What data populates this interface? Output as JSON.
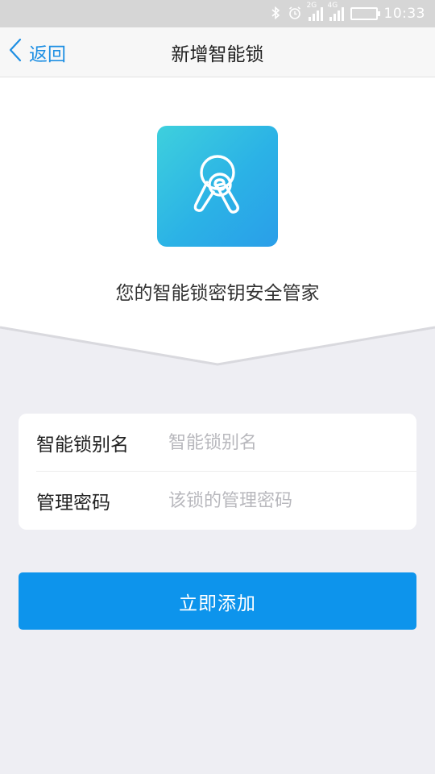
{
  "status_bar": {
    "network_1": "2G",
    "network_2": "4G",
    "time": "10:33",
    "icons": [
      "bluetooth-icon",
      "alarm-icon",
      "signal-icon",
      "signal-icon",
      "battery-icon"
    ]
  },
  "nav": {
    "back_label": "返回",
    "title": "新增智能锁"
  },
  "hero": {
    "icon": "keys-icon",
    "slogan": "您的智能锁密钥安全管家"
  },
  "form": {
    "alias": {
      "label": "智能锁别名",
      "value": "",
      "placeholder": "智能锁别名"
    },
    "password": {
      "label": "管理密码",
      "value": "",
      "placeholder": "该锁的管理密码"
    }
  },
  "submit": {
    "label": "立即添加"
  },
  "colors": {
    "accent": "#0d94ec",
    "nav_link": "#1e8fe3",
    "icon_gradient_start": "#3ed0dd",
    "icon_gradient_end": "#2a9ee9",
    "background": "#eeeef3"
  }
}
